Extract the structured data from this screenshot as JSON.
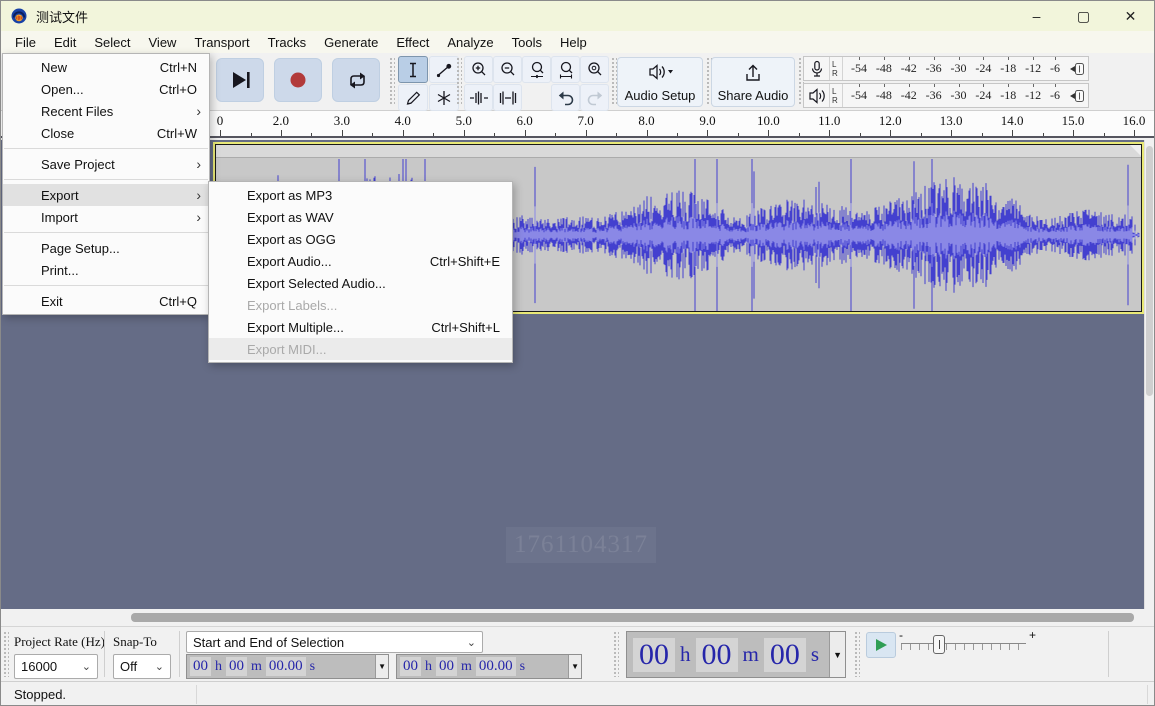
{
  "window": {
    "title": "测试文件"
  },
  "icons": {
    "minimize": "–",
    "maximize": "▢",
    "close": "✕",
    "submenu_arrow": "›",
    "dropdown_arrow": "▼",
    "combo_chevron": "⌄",
    "slider_minus": "-",
    "slider_plus": "+"
  },
  "menubar": [
    "File",
    "Edit",
    "Select",
    "View",
    "Transport",
    "Tracks",
    "Generate",
    "Effect",
    "Analyze",
    "Tools",
    "Help"
  ],
  "file_menu": [
    {
      "label": "New",
      "shortcut": "Ctrl+N"
    },
    {
      "label": "Open...",
      "shortcut": "Ctrl+O"
    },
    {
      "label": "Recent Files",
      "submenu": true
    },
    {
      "label": "Close",
      "shortcut": "Ctrl+W"
    },
    {
      "separator": true
    },
    {
      "label": "Save Project",
      "submenu": true
    },
    {
      "separator": true
    },
    {
      "label": "Export",
      "submenu": true,
      "highlighted": true
    },
    {
      "label": "Import",
      "submenu": true
    },
    {
      "separator": true
    },
    {
      "label": "Page Setup..."
    },
    {
      "label": "Print..."
    },
    {
      "separator": true
    },
    {
      "label": "Exit",
      "shortcut": "Ctrl+Q"
    }
  ],
  "export_menu": [
    {
      "label": "Export as MP3"
    },
    {
      "label": "Export as WAV"
    },
    {
      "label": "Export as OGG"
    },
    {
      "label": "Export Audio...",
      "shortcut": "Ctrl+Shift+E"
    },
    {
      "label": "Export Selected Audio..."
    },
    {
      "label": "Export Labels...",
      "disabled": true
    },
    {
      "label": "Export Multiple...",
      "shortcut": "Ctrl+Shift+L"
    },
    {
      "label": "Export MIDI...",
      "disabled": true,
      "shaded": true
    }
  ],
  "toolbar": {
    "audio_setup_label": "Audio Setup",
    "share_audio_label": "Share Audio",
    "meter_scale": [
      "-54",
      "-48",
      "-42",
      "-36",
      "-30",
      "-24",
      "-18",
      "-12",
      "-6"
    ],
    "meter_channels": [
      "L",
      "R"
    ]
  },
  "ruler_labels": [
    "0",
    "2.0",
    "3.0",
    "4.0",
    "5.0",
    "6.0",
    "7.0",
    "8.0",
    "9.0",
    "10.0",
    "11.0",
    "12.0",
    "13.0",
    "14.0",
    "15.0",
    "16.0"
  ],
  "watermark": "1761104317",
  "selection_toolbar": {
    "project_rate_label": "Project Rate (Hz)",
    "project_rate_value": "16000",
    "snap_label": "Snap-To",
    "snap_value": "Off",
    "selection_mode": "Start and End of Selection",
    "selection_start": [
      "00",
      "h",
      "00",
      "m",
      "00.00",
      "s"
    ],
    "selection_end": [
      "00",
      "h",
      "00",
      "m",
      "00.00",
      "s"
    ]
  },
  "time_display": [
    "00",
    "h",
    "00",
    "m",
    "00",
    "s"
  ],
  "status": "Stopped.",
  "colors": {
    "titlebar": "#f2f5db",
    "button_blue": "#cdd9ea",
    "waveform_blue": "#4340cf",
    "record_red": "#b23a3a",
    "track_selection_yellow": "#e9e977",
    "canvas_background": "#656c86"
  }
}
